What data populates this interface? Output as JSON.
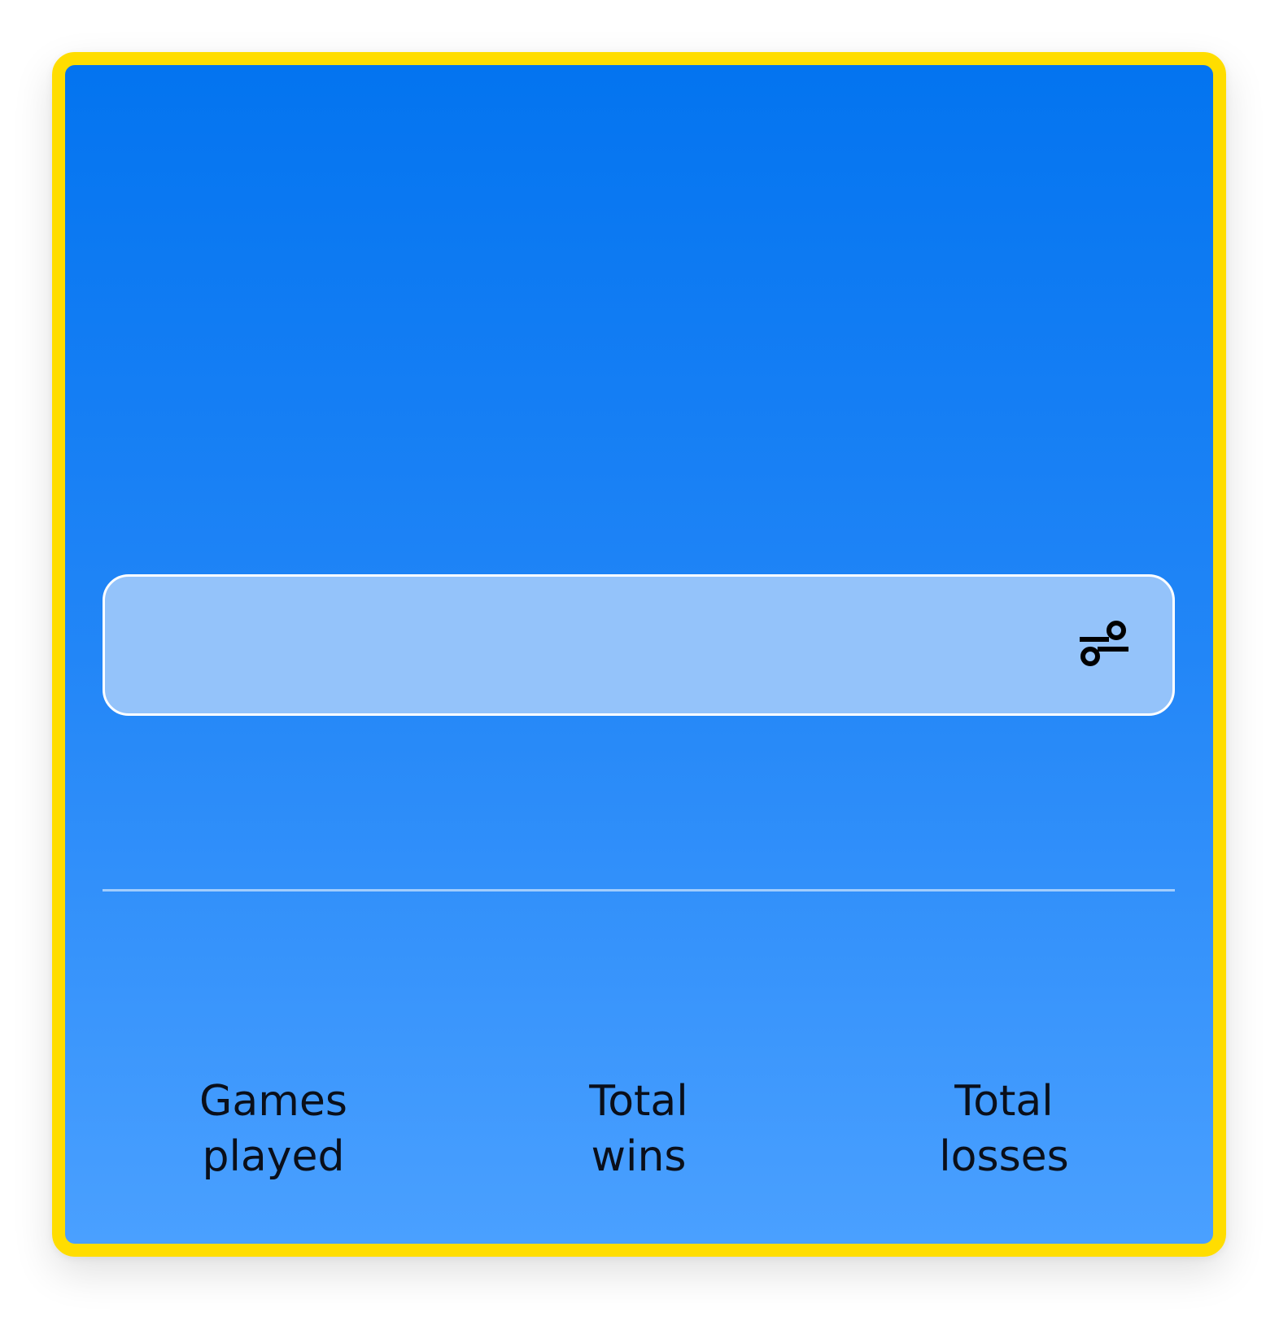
{
  "colors": {
    "border": "#FFDD00",
    "gradient_top": "#0374F0",
    "gradient_bottom": "#4AA0FF",
    "search_background": "#94C3FA",
    "text": "#0a0f1a"
  },
  "search": {
    "value": "",
    "placeholder": "",
    "filter_icon": "filter-icon"
  },
  "stats": [
    {
      "label": "Games\nplayed"
    },
    {
      "label": "Total\nwins"
    },
    {
      "label": "Total\nlosses"
    }
  ]
}
